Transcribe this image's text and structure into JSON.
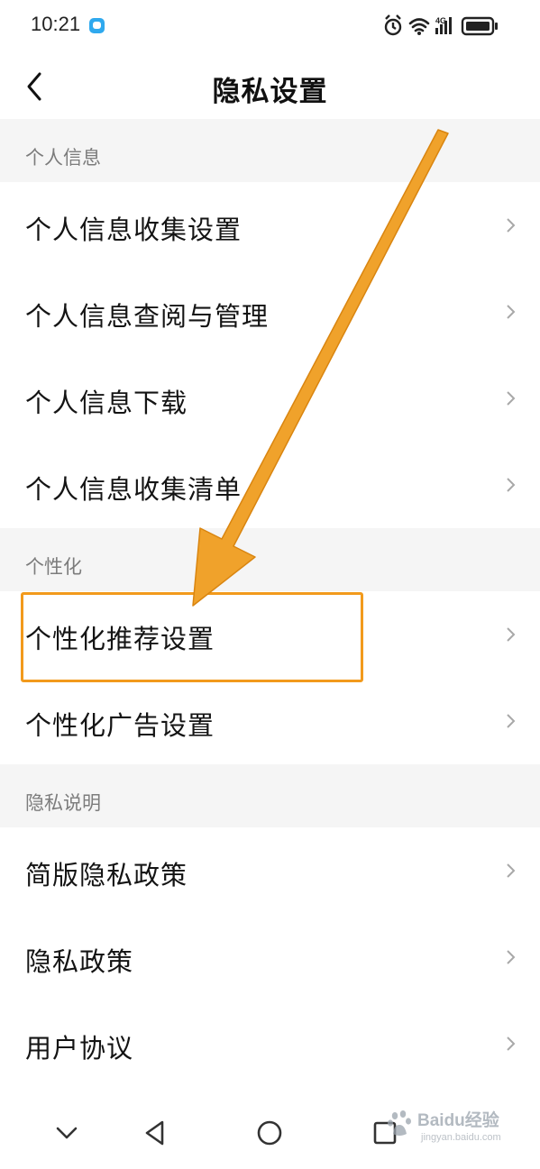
{
  "status_bar": {
    "time": "10:21",
    "network": "4G"
  },
  "header": {
    "title": "隐私设置"
  },
  "sections": [
    {
      "title": "个人信息",
      "items": [
        {
          "label": "个人信息收集设置"
        },
        {
          "label": "个人信息查阅与管理"
        },
        {
          "label": "个人信息下载"
        },
        {
          "label": "个人信息收集清单"
        }
      ]
    },
    {
      "title": "个性化",
      "items": [
        {
          "label": "个性化推荐设置"
        },
        {
          "label": "个性化广告设置"
        }
      ]
    },
    {
      "title": "隐私说明",
      "items": [
        {
          "label": "简版隐私政策"
        },
        {
          "label": "隐私政策"
        },
        {
          "label": "用户协议"
        }
      ]
    }
  ],
  "nav_bar": {
    "buttons": [
      "chevron-down-icon",
      "back-triangle-icon",
      "home-circle-icon",
      "recents-square-icon"
    ]
  },
  "watermark": {
    "brand": "Baidu经验",
    "url": "jingyan.baidu.com"
  },
  "annotations": {
    "highlight_color": "#f29a1c",
    "highlighted_item": "个性化推荐设置"
  }
}
